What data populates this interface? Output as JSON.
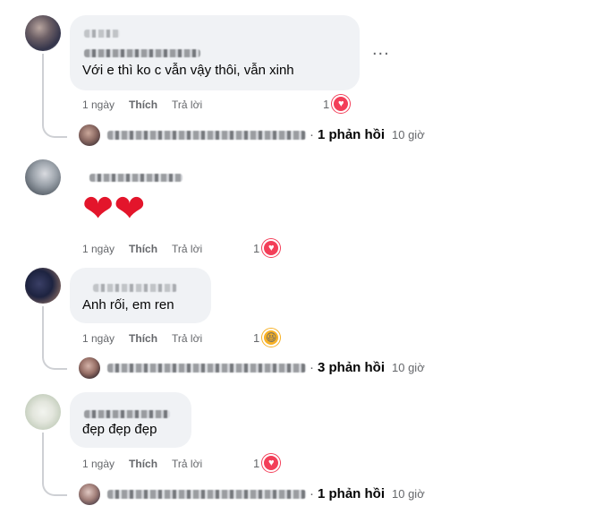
{
  "comments": [
    {
      "text": "Với e thì ko c vẫn vậy thôi, vẫn xinh",
      "actions": {
        "time": "1 ngày",
        "like": "Thích",
        "reply": "Trả lời"
      },
      "reaction": {
        "count": "1",
        "icon": "heart-icon"
      },
      "replies": {
        "label": "1 phản hồi",
        "time": "10 giờ"
      }
    },
    {
      "emoji_text": "❤❤",
      "actions": {
        "time": "1 ngày",
        "like": "Thích",
        "reply": "Trả lời"
      },
      "reaction": {
        "count": "1",
        "icon": "heart-icon"
      }
    },
    {
      "text": "Anh rối, em ren",
      "actions": {
        "time": "1 ngày",
        "like": "Thích",
        "reply": "Trả lời"
      },
      "reaction": {
        "count": "1",
        "icon": "haha-icon"
      },
      "replies": {
        "label": "3 phản hồi",
        "time": "10 giờ"
      }
    },
    {
      "text": "đẹp đẹp đẹp",
      "actions": {
        "time": "1 ngày",
        "like": "Thích",
        "reply": "Trả lời"
      },
      "reaction": {
        "count": "1",
        "icon": "heart-icon"
      },
      "replies": {
        "label": "1 phản hồi",
        "time": "10 giờ"
      }
    }
  ],
  "more_options": "...",
  "colors": {
    "bubble": "#f0f2f5",
    "meta": "#65676b",
    "heart": "#f33e58",
    "haha": "#f7b125"
  }
}
